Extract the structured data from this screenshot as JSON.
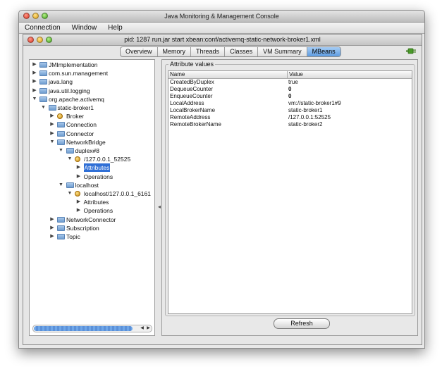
{
  "app": {
    "title": "Java Monitoring & Management Console",
    "menu": [
      "Connection",
      "Window",
      "Help"
    ]
  },
  "inner": {
    "title": "pid: 1287 run.jar start xbean:conf/activemq-static-network-broker1.xml",
    "tabs": [
      "Overview",
      "Memory",
      "Threads",
      "Classes",
      "VM Summary",
      "MBeans"
    ],
    "active_tab": "MBeans"
  },
  "tree": {
    "items": [
      {
        "label": "JMImplementation",
        "icon": "folder-icon",
        "expander": "collapsed",
        "depth": 0
      },
      {
        "label": "com.sun.management",
        "icon": "folder-icon",
        "expander": "collapsed",
        "depth": 0
      },
      {
        "label": "java.lang",
        "icon": "folder-icon",
        "expander": "collapsed",
        "depth": 0
      },
      {
        "label": "java.util.logging",
        "icon": "folder-icon",
        "expander": "collapsed",
        "depth": 0
      },
      {
        "label": "org.apache.activemq",
        "icon": "folder-icon",
        "expander": "expanded",
        "depth": 0
      },
      {
        "label": "static-broker1",
        "icon": "folder-icon",
        "expander": "expanded",
        "depth": 1
      },
      {
        "label": "Broker",
        "icon": "mbean-icon",
        "expander": "collapsed",
        "depth": 2
      },
      {
        "label": "Connection",
        "icon": "folder-icon",
        "expander": "collapsed",
        "depth": 2
      },
      {
        "label": "Connector",
        "icon": "folder-icon",
        "expander": "collapsed",
        "depth": 2
      },
      {
        "label": "NetworkBridge",
        "icon": "folder-icon",
        "expander": "expanded",
        "depth": 2
      },
      {
        "label": "duplex#8",
        "icon": "folder-icon",
        "expander": "expanded",
        "depth": 3
      },
      {
        "label": "/127.0.0.1_52525",
        "icon": "mbean-icon",
        "expander": "expanded",
        "depth": 4
      },
      {
        "label": "Attributes",
        "icon": "",
        "expander": "collapsed",
        "depth": 5,
        "selected": true
      },
      {
        "label": "Operations",
        "icon": "",
        "expander": "collapsed",
        "depth": 5
      },
      {
        "label": "localhost",
        "icon": "folder-icon",
        "expander": "expanded",
        "depth": 3
      },
      {
        "label": "localhost/127.0.0.1_6161",
        "icon": "mbean-icon",
        "expander": "expanded",
        "depth": 4
      },
      {
        "label": "Attributes",
        "icon": "",
        "expander": "collapsed",
        "depth": 5
      },
      {
        "label": "Operations",
        "icon": "",
        "expander": "collapsed",
        "depth": 5
      },
      {
        "label": "NetworkConnector",
        "icon": "folder-icon",
        "expander": "collapsed",
        "depth": 2
      },
      {
        "label": "Subscription",
        "icon": "folder-icon",
        "expander": "collapsed",
        "depth": 2
      },
      {
        "label": "Topic",
        "icon": "folder-icon",
        "expander": "collapsed",
        "depth": 2
      }
    ]
  },
  "attributes": {
    "legend": "Attribute values",
    "columns": [
      "Name",
      "Value"
    ],
    "rows": [
      {
        "name": "CreatedByDuplex",
        "value": "true",
        "bold": false
      },
      {
        "name": "DequeueCounter",
        "value": "0",
        "bold": true
      },
      {
        "name": "EnqueueCounter",
        "value": "0",
        "bold": true
      },
      {
        "name": "LocalAddress",
        "value": "vm://static-broker1#9",
        "bold": false
      },
      {
        "name": "LocalBrokerName",
        "value": "static-broker1",
        "bold": false
      },
      {
        "name": "RemoteAddress",
        "value": "/127.0.0.1:52525",
        "bold": false
      },
      {
        "name": "RemoteBrokerName",
        "value": "static-broker2",
        "bold": false
      }
    ],
    "refresh_label": "Refresh"
  },
  "colors": {
    "selection": "#2f6fd6",
    "active_tab": "#5d9be0"
  }
}
